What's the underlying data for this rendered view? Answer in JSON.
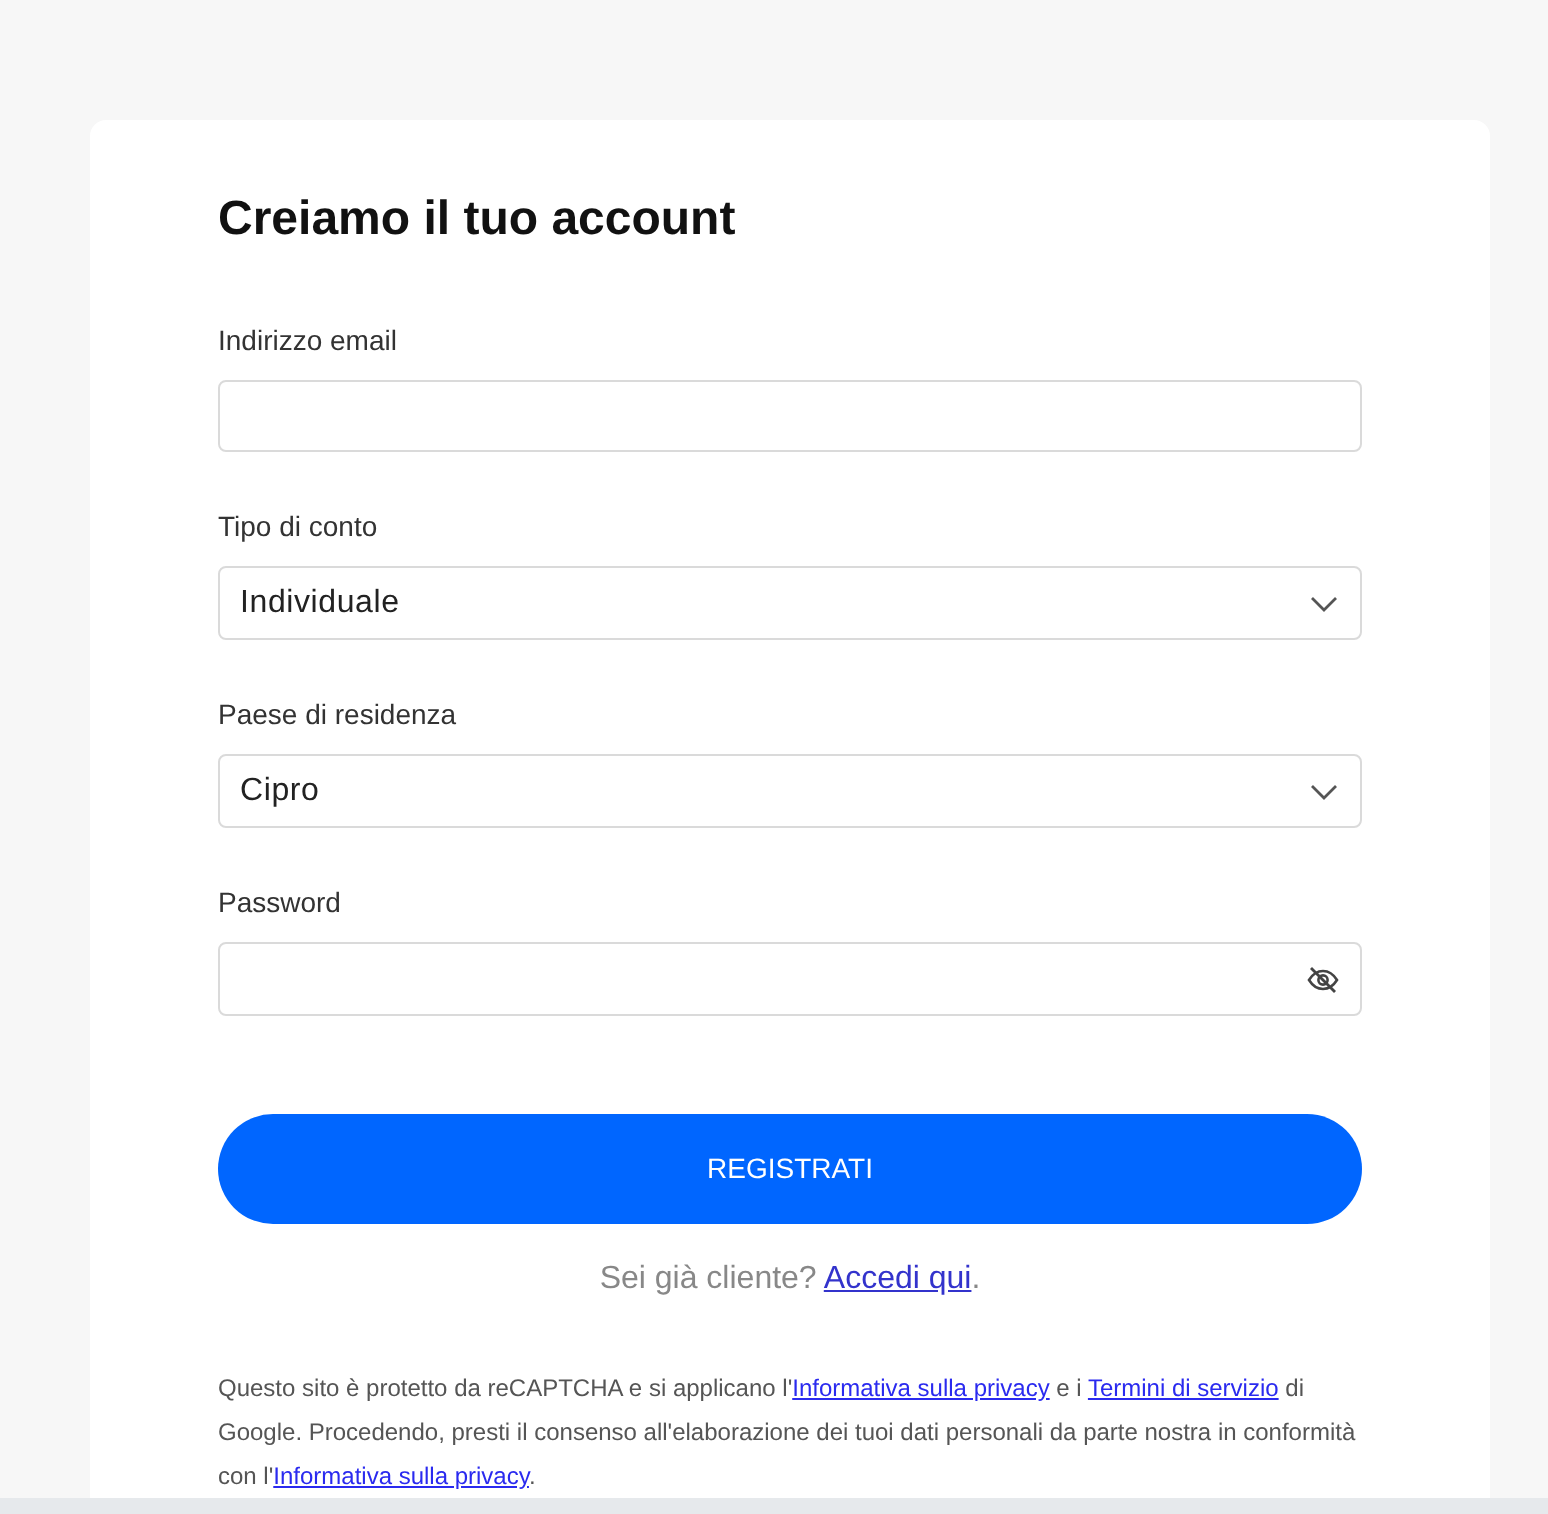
{
  "form": {
    "title": "Creiamo il tuo account",
    "fields": [
      {
        "kind": "email",
        "label": "Indirizzo email"
      },
      {
        "kind": "select",
        "label": "Tipo di conto",
        "value": "Individuale"
      },
      {
        "kind": "select",
        "label": "Paese di residenza",
        "value": "Cipro"
      },
      {
        "kind": "password",
        "label": "Password"
      }
    ],
    "submit_button": "REGISTRATI",
    "login_prompt": [
      {
        "kind": "text",
        "text": "Sei già cliente? "
      },
      {
        "kind": "link",
        "text": "Accedi qui"
      },
      {
        "kind": "text",
        "text": "."
      }
    ],
    "legal_notice": [
      {
        "kind": "text",
        "text": "Questo sito è protetto da reCAPTCHA e si applicano l'"
      },
      {
        "kind": "link",
        "text": "Informativa sulla privacy"
      },
      {
        "kind": "text",
        "text": " e i "
      },
      {
        "kind": "link",
        "text": "Termini di servizio"
      },
      {
        "kind": "text",
        "text": " di Google. Procedendo, presti il consenso all'elaborazione dei tuoi dati personali da parte nostra in conformità con l'"
      },
      {
        "kind": "link",
        "text": "Informativa sulla privacy"
      },
      {
        "kind": "text",
        "text": "."
      }
    ]
  }
}
